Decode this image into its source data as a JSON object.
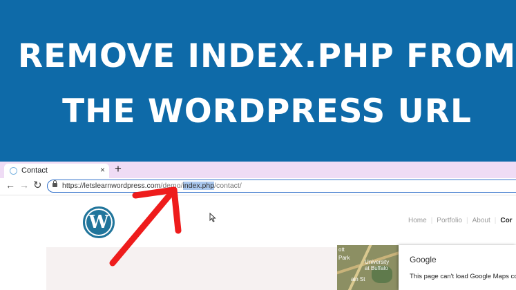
{
  "banner": {
    "line1": "REMOVE INDEX.PHP FROM",
    "line2": "THE WORDPRESS URL",
    "background": "#0e6aa8"
  },
  "browser": {
    "tab_title": "Contact",
    "tab_close": "×",
    "new_tab": "+",
    "url_host": "https://letslearnwordpress.com",
    "url_path_1": "/demo/",
    "url_selected": "index.php",
    "url_path_2": "/contact/"
  },
  "site": {
    "logo_letter": "W",
    "nav": [
      "Home",
      "Portfolio",
      "About",
      "Cor"
    ]
  },
  "map": {
    "label1": "ott",
    "label2": "Park",
    "label3": "University\nat Buffalo",
    "label4": "ain St"
  },
  "gmaps": {
    "title": "Google",
    "message": "This page can't load Google Maps corr"
  },
  "annotation": {
    "arrow_color": "#ee1c1c"
  }
}
